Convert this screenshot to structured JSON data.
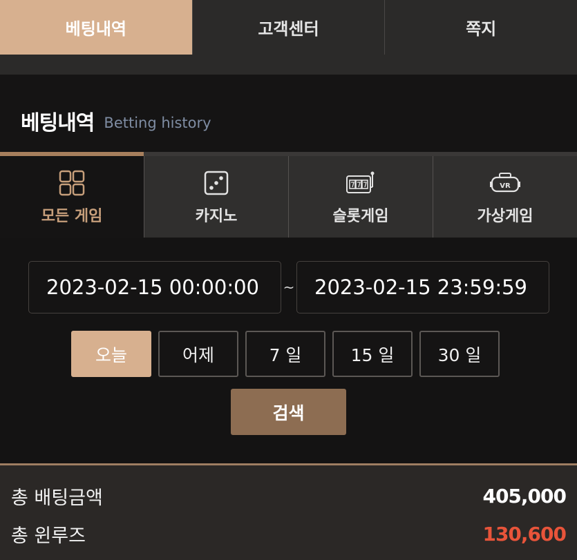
{
  "top_tabs": [
    {
      "label": "베팅내역"
    },
    {
      "label": "고객센터"
    },
    {
      "label": "쪽지"
    }
  ],
  "section": {
    "title": "베팅내역",
    "subtitle": "Betting history"
  },
  "categories": [
    {
      "label": "모든 게임",
      "icon": "grid-icon"
    },
    {
      "label": "카지노",
      "icon": "dice-icon"
    },
    {
      "label": "슬롯게임",
      "icon": "slot-machine-icon"
    },
    {
      "label": "가상게임",
      "icon": "vr-headset-icon"
    }
  ],
  "date_range": {
    "start": "2023-02-15 00:00:00",
    "separator": "~",
    "end": "2023-02-15 23:59:59"
  },
  "quick_ranges": [
    {
      "label": "오늘"
    },
    {
      "label": "어제"
    },
    {
      "label": "7 일"
    },
    {
      "label": "15 일"
    },
    {
      "label": "30 일"
    }
  ],
  "search_label": "검색",
  "summary": {
    "total_bet_label": "총 배팅금액",
    "total_bet_value": "405,000",
    "total_winloss_label": "총 윈루즈",
    "total_winloss_value": "130,600"
  },
  "colors": {
    "accent": "#d7b08f",
    "active_category_text": "#c79f7b",
    "search_button": "#8d6d52",
    "loss_value": "#e8543a"
  }
}
